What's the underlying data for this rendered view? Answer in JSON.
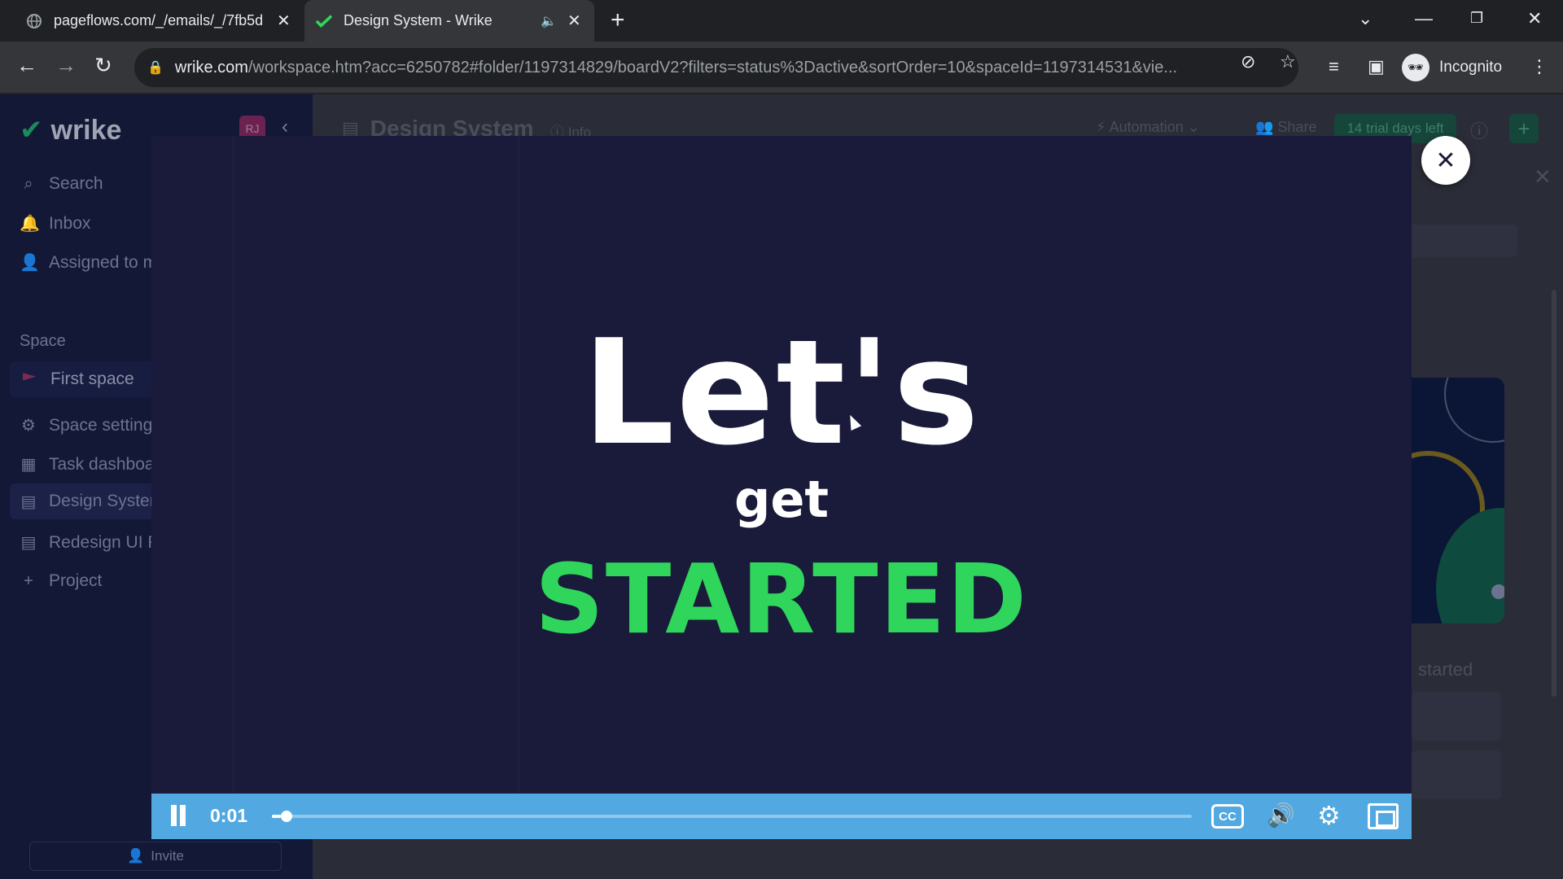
{
  "browser": {
    "tabs": [
      {
        "title": "pageflows.com/_/emails/_/7fb5d",
        "active": false
      },
      {
        "title": "Design System - Wrike",
        "active": true
      }
    ],
    "url_host": "wrike.com",
    "url_path": "/workspace.htm?acc=6250782#folder/1197314829/boardV2?filters=status%3Dactive&sortOrder=10&spaceId=1197314531&vie...",
    "profile_label": "Incognito"
  },
  "sidebar": {
    "brand": "wrike",
    "avatar_initials": "RJ",
    "nav": [
      {
        "label": "Search",
        "icon": "search-icon"
      },
      {
        "label": "Inbox",
        "icon": "bell-icon"
      },
      {
        "label": "Assigned to m",
        "icon": "user-icon"
      }
    ],
    "section_label": "Space",
    "space_name": "First space",
    "items": [
      {
        "label": "Space setting",
        "icon": "gear-icon"
      },
      {
        "label": "Task dashboar",
        "icon": "board-icon"
      },
      {
        "label": "Design Systen",
        "icon": "doc-icon"
      },
      {
        "label": "Redesign UI F",
        "icon": "doc-icon"
      },
      {
        "label": "Project",
        "icon": "plus-icon"
      }
    ],
    "invite_label": "Invite"
  },
  "header": {
    "title": "Design System",
    "info_label": "Info",
    "automation_label": "Automation",
    "share_label": "Share",
    "trial_label": "14 trial days left"
  },
  "panel": {
    "started_label": "started"
  },
  "video": {
    "line1": "Let's",
    "line2": "get",
    "line3": "STARTED",
    "time": "0:01",
    "progress_fraction": 0.01,
    "cc_label": "CC",
    "accent_color": "#2fd65b",
    "controls_color": "#52a8e0"
  }
}
